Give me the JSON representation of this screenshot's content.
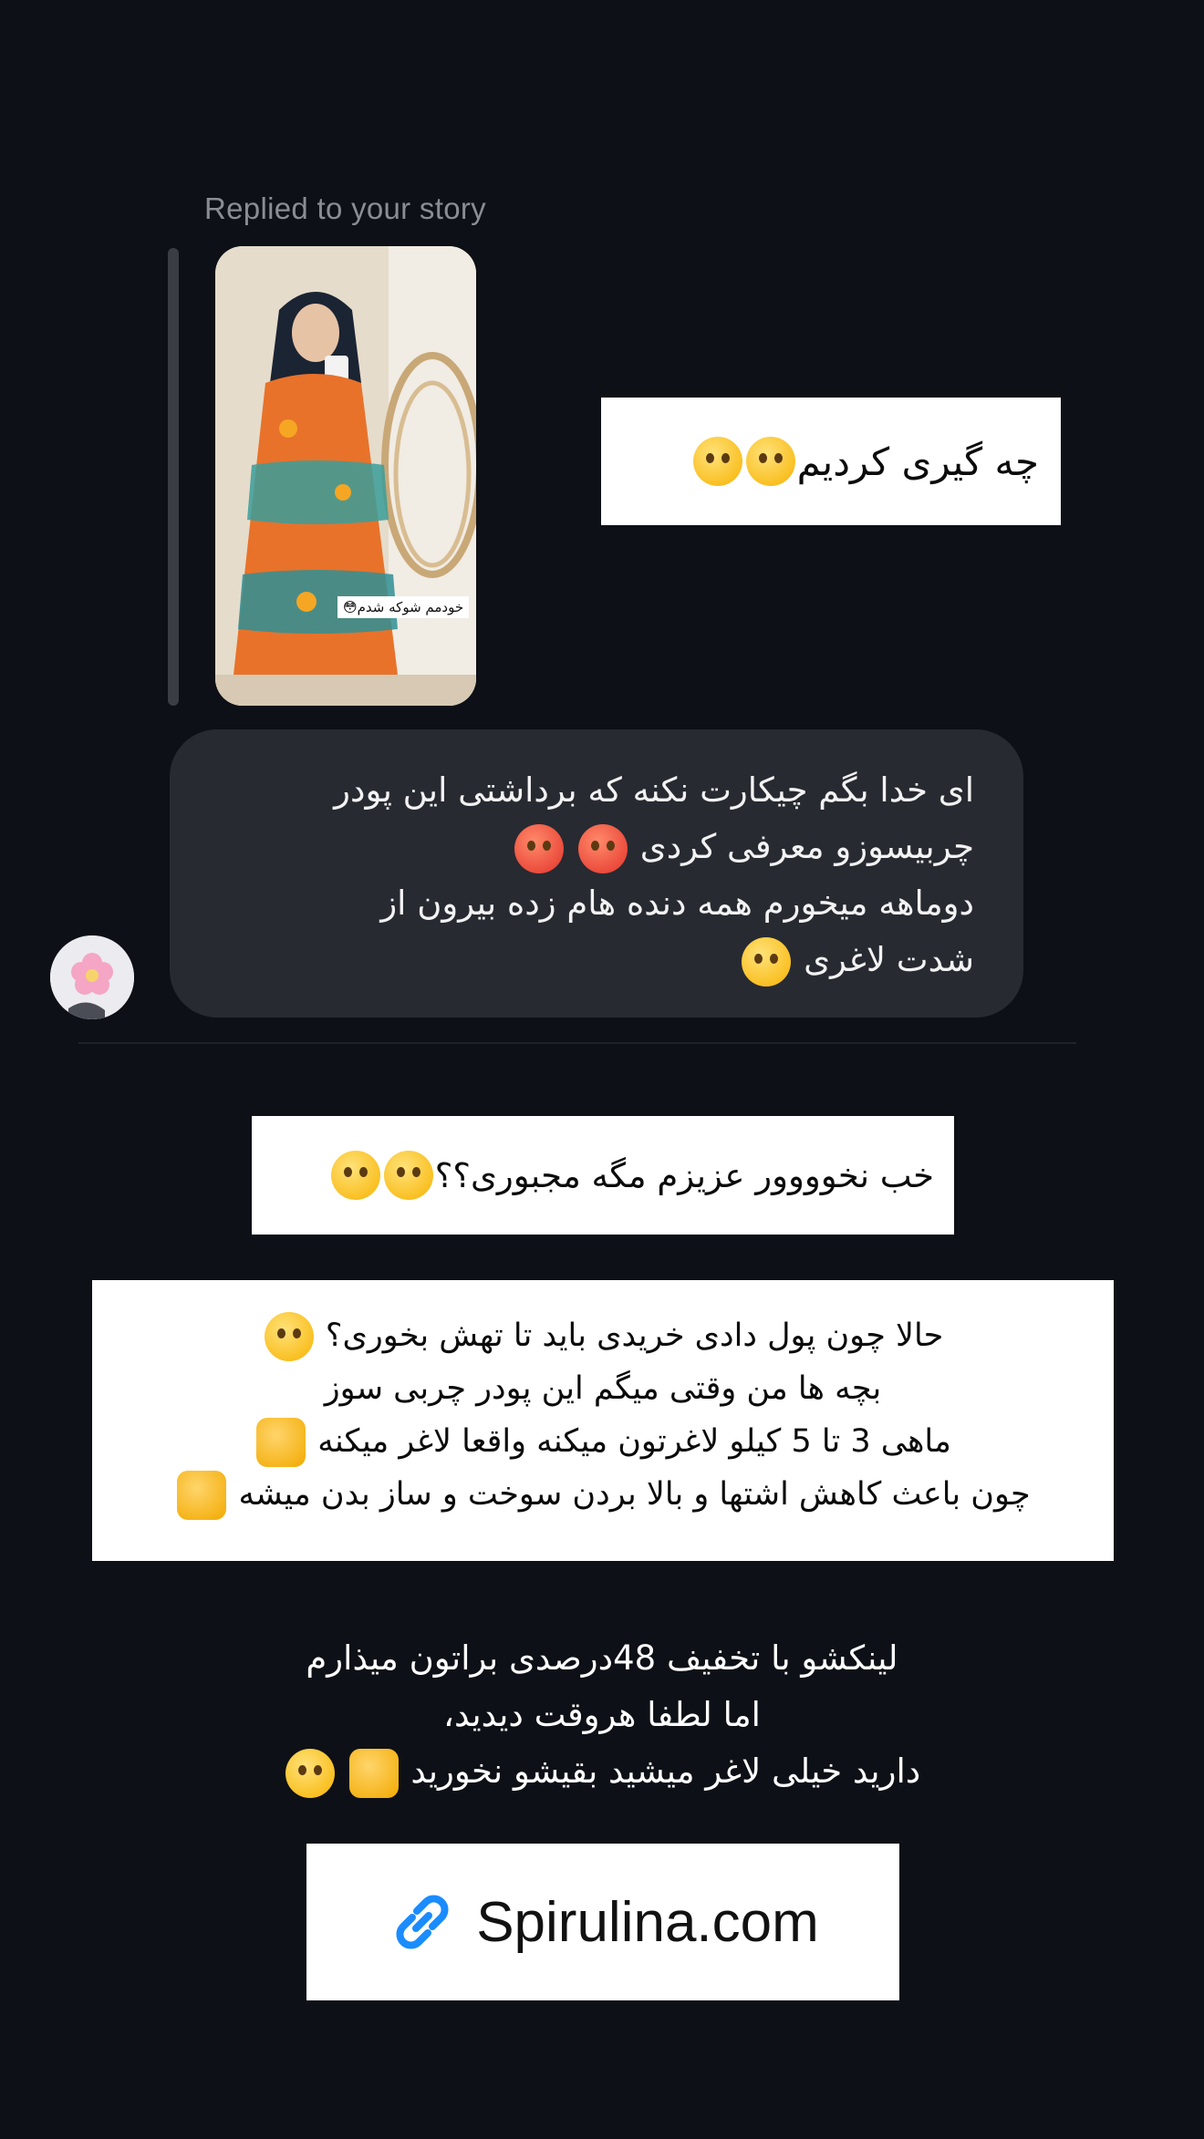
{
  "story_reply": {
    "label": "Replied to your story",
    "caption": "خودمم شوکه شدم😳"
  },
  "sticker_1": {
    "text": "چه گیری کردیم",
    "emojis": [
      "flushed-face",
      "grinning-sweat-face"
    ]
  },
  "incoming_message": {
    "lines": [
      "ای خدا بگم چیکارت نکنه که برداشتی این پودر",
      "چربیسوزو معرفی کردی",
      "دوماهه میخورم همه دنده هام زده بیرون از",
      "شدت لاغری"
    ],
    "emojis": [
      "angry-face",
      "angry-face",
      "crying-face"
    ]
  },
  "sticker_2": {
    "text": "خب نخوووور عزیزم  مگه مجبوری؟؟",
    "emojis": [
      "flushed-face",
      "flushed-face"
    ]
  },
  "sticker_3": {
    "lines": [
      "حالا چون پول دادی خریدی باید تا تهش بخوری؟",
      "بچه ها من وقتی میگم این پودر چربی سوز",
      "ماهی 3 تا 5 کیلو لاغرتون میکنه واقعا لاغر میکنه",
      "چون باعث کاهش اشتها و بالا بردن سوخت و ساز بدن میشه"
    ],
    "emojis": [
      "flushed-face",
      "thumbs-up",
      "ok-hand"
    ]
  },
  "plain_text": {
    "lines": [
      "لینکشو با تخفیف 48درصدی براتون میذارم",
      "اما لطفا هروقت دیدید،",
      "دارید خیلی لاغر میشید بقیشو نخورید"
    ],
    "emojis": [
      "pointing-down-hand",
      "grinning-sweat-face"
    ]
  },
  "link_sticker": {
    "icon": "link-icon",
    "text": "Spirulina.com",
    "accent": "#1a8cff"
  },
  "colors": {
    "background": "#0d1016",
    "bubble": "#272a31",
    "muted": "#8a8d94"
  }
}
